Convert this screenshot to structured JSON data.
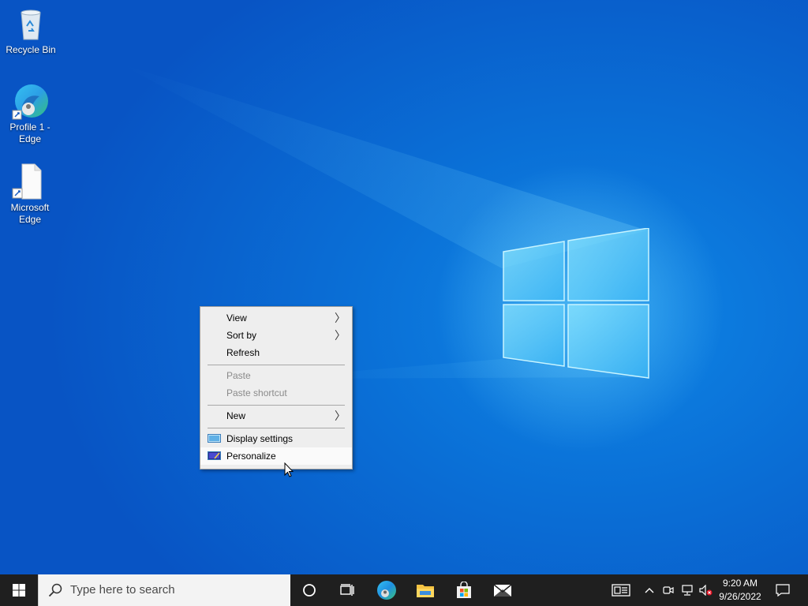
{
  "desktop": {
    "icons": [
      {
        "label": "Recycle Bin"
      },
      {
        "label": "Profile 1 -\nEdge"
      },
      {
        "label": "Microsoft\nEdge"
      }
    ]
  },
  "context_menu": {
    "items": [
      {
        "label": "View",
        "has_submenu": true,
        "enabled": true
      },
      {
        "label": "Sort by",
        "has_submenu": true,
        "enabled": true
      },
      {
        "label": "Refresh",
        "enabled": true
      },
      {
        "label": "Paste",
        "enabled": false
      },
      {
        "label": "Paste shortcut",
        "enabled": false
      },
      {
        "label": "New",
        "has_submenu": true,
        "enabled": true
      },
      {
        "label": "Display settings",
        "icon": "display-icon",
        "enabled": true
      },
      {
        "label": "Personalize",
        "icon": "personalize-icon",
        "enabled": true,
        "hovered": true
      }
    ],
    "submenu_arrow": "〉"
  },
  "taskbar": {
    "search_placeholder": "Type here to search",
    "apps": [
      "cortana-icon",
      "task-view-icon",
      "edge-icon",
      "file-explorer-icon",
      "store-icon",
      "mail-icon"
    ],
    "tray": [
      "news-icon",
      "show-hidden-icons",
      "meet-now-icon",
      "network-icon",
      "volume-muted-icon"
    ],
    "time": "9:20 AM",
    "date": "9/26/2022"
  },
  "colors": {
    "taskbar": "#1f1f1f",
    "desktop": "#0a6fd6",
    "menu_bg": "#eeeeee"
  }
}
